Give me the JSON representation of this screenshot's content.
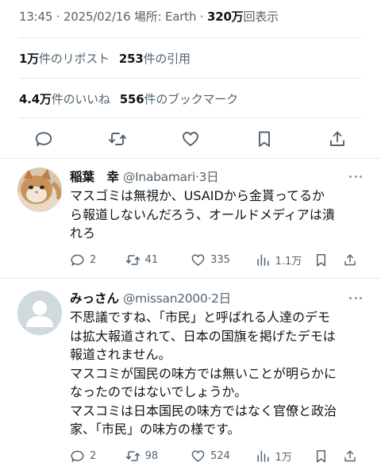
{
  "tweet": {
    "time": "13:45",
    "date": "2025/02/16",
    "location": "場所: Earth",
    "views_value": "320万",
    "views_label": "回表示",
    "reposts_value": "1万",
    "reposts_label": "件のリポスト",
    "quotes_value": "253",
    "quotes_label": "件の引用",
    "likes_value": "4.4万",
    "likes_label": "件のいいね",
    "bookmarks_value": "556",
    "bookmarks_label": "件のブックマーク"
  },
  "icons": {
    "reply": "reply-icon",
    "retweet": "retweet-icon",
    "like": "heart-icon",
    "bookmark": "bookmark-icon",
    "share": "share-icon",
    "views": "views-chart-icon",
    "more": "more-dots-icon"
  },
  "replies": [
    {
      "name": "稲葉　幸",
      "handle": "@Inabamari",
      "time": "3日",
      "lines": [
        "マスゴミは無視か、USAIDから金貰ってるか",
        "ら報道しないんだろう、オールドメディアは潰",
        "れろ"
      ],
      "reply_count": "2",
      "retweet_count": "41",
      "like_count": "335",
      "view_count": "1.1万",
      "avatar": "cat-photo"
    },
    {
      "name": "みっさん",
      "handle": "@missan2000",
      "time": "2日",
      "lines": [
        "不思議ですね、「市民」と呼ばれる人達のデモ",
        "は拡大報道されて、日本の国旗を掲げたデモは",
        "報道されません。",
        "マスコミが国民の味方では無いことが明らかに",
        "なったのではないでしょうか。",
        "マスコミは日本国民の味方ではなく官僚と政治",
        "家、「市民」の味方の様です。"
      ],
      "reply_count": "2",
      "retweet_count": "98",
      "like_count": "524",
      "view_count": "1万",
      "avatar": "default-avatar"
    }
  ],
  "colors": {
    "text": "#0f1419",
    "secondary": "#536471",
    "divider": "#e6e9eb"
  }
}
